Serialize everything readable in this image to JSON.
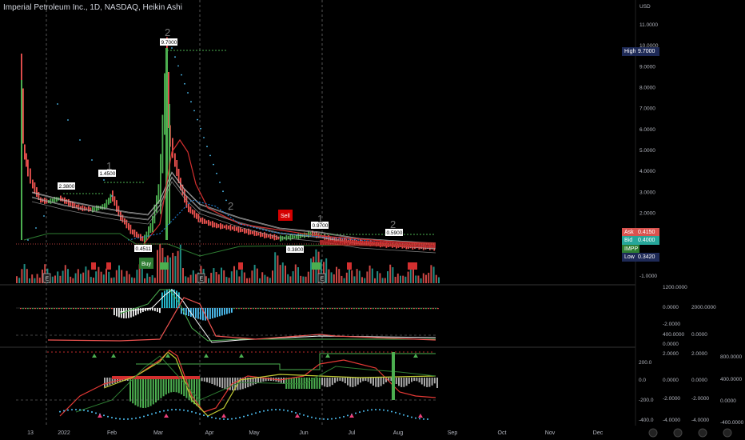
{
  "header": {
    "title": "Imperial Petroleum Inc., 1D, NASDAQ, Heikin Ashi",
    "currency": "USD"
  },
  "main_axis": {
    "ticks": [
      "11.0000",
      "10.0000",
      "9.0000",
      "8.0000",
      "7.0000",
      "6.0000",
      "5.0000",
      "4.0000",
      "3.0000",
      "2.0000",
      "1.0000",
      "-1.0000"
    ],
    "ylim": [
      -1.5,
      12
    ]
  },
  "price_tags": [
    {
      "label": "High",
      "value": "9.7000",
      "color": "#1e2a57"
    },
    {
      "label": "Ask",
      "value": "0.4150",
      "color": "#d9534f"
    },
    {
      "label": "Bid",
      "value": "0.4000",
      "color": "#26a69a"
    },
    {
      "label": "IMPP",
      "value": "",
      "color": "#2e7d32"
    },
    {
      "label": "Low",
      "value": "0.3420",
      "color": "#1e2a57"
    }
  ],
  "annotations": {
    "value_labels": [
      "2.3800",
      "1.4500",
      "9.7000",
      "0.4511",
      "0.3800",
      "0.9700",
      "0.5900"
    ],
    "wave_counts": [
      "2",
      "1",
      "2",
      "1",
      "2",
      "2"
    ],
    "buy_label": "Buy",
    "sell_label": "Sell",
    "earnings_marker": "E"
  },
  "macd_axis": {
    "left_ticks": [
      "1200.0000",
      "0.0000",
      "-2.0000",
      "400.0000",
      "0.0000",
      "-4.0000"
    ],
    "right_ticks": [
      "2000.0000",
      "0.0000"
    ]
  },
  "osc_axis": {
    "col1": [
      "2.0000",
      "0.0000",
      "-2.0000",
      "-4.0000"
    ],
    "col2": [
      "2.0000",
      "0.0000",
      "-2.0000",
      "-4.0000"
    ],
    "col3": [
      "800.0000",
      "400.0000",
      "0.0000",
      "-400.0000"
    ],
    "left_ticks": [
      "200.0",
      "0.0",
      "-200.0",
      "-400.0"
    ]
  },
  "x_axis": {
    "labels": [
      "13",
      "2022",
      "Feb",
      "Mar",
      "Apr",
      "May",
      "Jun",
      "Jul",
      "Aug",
      "Sep",
      "Oct",
      "Nov",
      "Dec"
    ]
  },
  "colors": {
    "background": "#000000",
    "up": "#26a69a",
    "down": "#ef5350",
    "bright_green": "#4caf50"
  },
  "chart_data": {
    "type": "line",
    "title": "Imperial Petroleum Inc., 1D, NASDAQ, Heikin Ashi",
    "xlabel": "",
    "ylabel": "USD",
    "categories": [
      "Dec 13",
      "2022",
      "Feb",
      "Mar",
      "Apr",
      "May",
      "Jun",
      "Jul",
      "Aug"
    ],
    "series": [
      {
        "values": [
          8.2,
          2.0,
          1.45,
          9.7,
          1.8,
          0.9,
          0.97,
          0.6,
          0.4
        ]
      }
    ],
    "ylim": [
      -1.5,
      12
    ],
    "grid": false,
    "legend": "none"
  }
}
